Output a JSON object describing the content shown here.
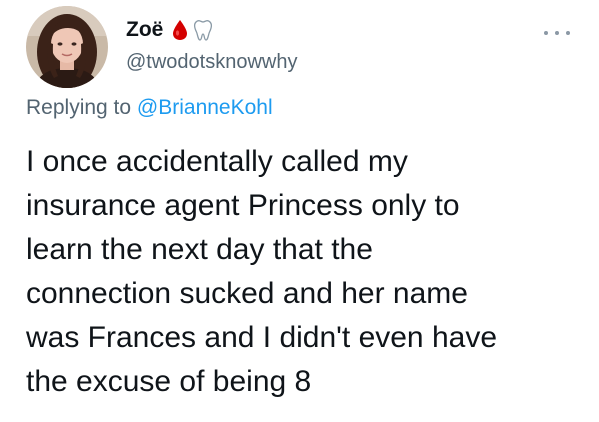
{
  "tweet": {
    "author": {
      "display_name": "Zoë",
      "handle": "@twodotsknowwhy",
      "name_emojis": [
        "drop-of-blood-icon",
        "tooth-icon"
      ]
    },
    "more_icon": "more-horizontal-icon",
    "replying_prefix": "Replying to",
    "replying_to": "@BrianneKohl",
    "text_lines": [
      "I once accidentally called my",
      "insurance agent Princess only to",
      "learn the next day that the",
      "connection sucked and her name",
      "was Frances and I didn't even have",
      "the excuse of being 8"
    ]
  },
  "colors": {
    "text": "#0f1419",
    "secondary": "#536471",
    "link": "#1d9bf0",
    "blood_drop": "#d40000"
  }
}
